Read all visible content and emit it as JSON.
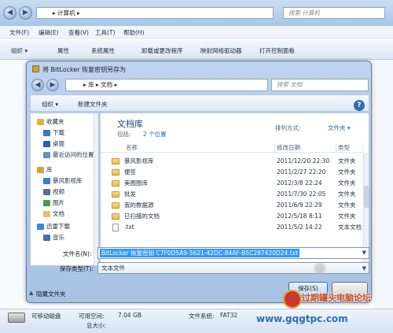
{
  "explorer": {
    "back_glyph": "◀",
    "forward_glyph": "▶",
    "address_text": "▸ 计算机 ▸",
    "search_placeholder": "搜索 计算机",
    "menu": [
      "文件(F)",
      "编辑(E)",
      "查看(V)",
      "工具(T)",
      "帮助(H)"
    ],
    "toolbar": [
      "组织 ▾",
      "属性",
      "系统属性",
      "卸载或更改程序",
      "映射网络驱动器",
      "打开控制面板"
    ],
    "status": {
      "drive_label": "可移动磁盘",
      "available_label": "可用空间:",
      "available_value": "7.04 GB",
      "filesystem_label": "文件系统:",
      "filesystem_value": "FAT32",
      "total_label": "总大小:"
    }
  },
  "dialog": {
    "title": "将 BitLocker 恢复密钥另存为",
    "address": "▸ 库 ▸ 文档 ▸",
    "search_placeholder": "搜索 文档",
    "toolbar": {
      "organize": "组织 ▾",
      "new_folder": "新建文件夹"
    },
    "nav": [
      {
        "label": "收藏夹",
        "color": "#e6b23a"
      },
      {
        "label": "下载",
        "color": "#3b78c6"
      },
      {
        "label": "桌面",
        "color": "#2d5fa8"
      },
      {
        "label": "最近访问的位置",
        "color": "#6f8fb6"
      },
      {
        "label": "库",
        "color": "#d8a13a"
      },
      {
        "label": "暴风影视库",
        "color": "#3a7bd0"
      },
      {
        "label": "视频",
        "color": "#5a6f8c"
      },
      {
        "label": "图片",
        "color": "#4f9a4a"
      },
      {
        "label": "文档",
        "color": "#e2c36a"
      },
      {
        "label": "迅雷下载",
        "color": "#2f8be0"
      },
      {
        "label": "音乐",
        "color": "#3e6fb8"
      }
    ],
    "library": {
      "title": "文档库",
      "includes_label": "包括:",
      "includes_count": "2 个位置",
      "arrange_label": "排列方式:",
      "arrange_value": "文件夹 ▾"
    },
    "columns": [
      "名称",
      "修改日期",
      "类型"
    ],
    "files": [
      {
        "name": "暴风影视库",
        "date": "2011/12/20 22:30",
        "type": "文件夹",
        "kind": "folder"
      },
      {
        "name": "便签",
        "date": "2011/2/27 22:20",
        "type": "文件夹",
        "kind": "folder"
      },
      {
        "name": "美图图库",
        "date": "2012/3/8 22:24",
        "type": "文件夹",
        "kind": "folder"
      },
      {
        "name": "批发",
        "date": "2011/7/30 22:05",
        "type": "文件夹",
        "kind": "folder"
      },
      {
        "name": "我的数据源",
        "date": "2011/6/9 22:29",
        "type": "文件夹",
        "kind": "folder"
      },
      {
        "name": "已扫描的文档",
        "date": "2012/5/18 8:11",
        "type": "文件夹",
        "kind": "folder"
      },
      {
        "name": ".txt",
        "date": "2011/5/2 14:22",
        "type": "文本文档",
        "kind": "txt"
      }
    ],
    "filename_label": "文件名(N):",
    "filename_value": "BitLocker 恢复密钥 C7F0D5A9-5621-42DC-84AF-B5C287420D24.txt",
    "filetype_label": "保存类型(T):",
    "filetype_value": "文本文件",
    "hide_folders": "隐藏文件夹",
    "save_button": "保存(S)"
  },
  "watermark": {
    "text": "过期罐头电脑论坛",
    "url": "www.gqgtpc.com"
  }
}
